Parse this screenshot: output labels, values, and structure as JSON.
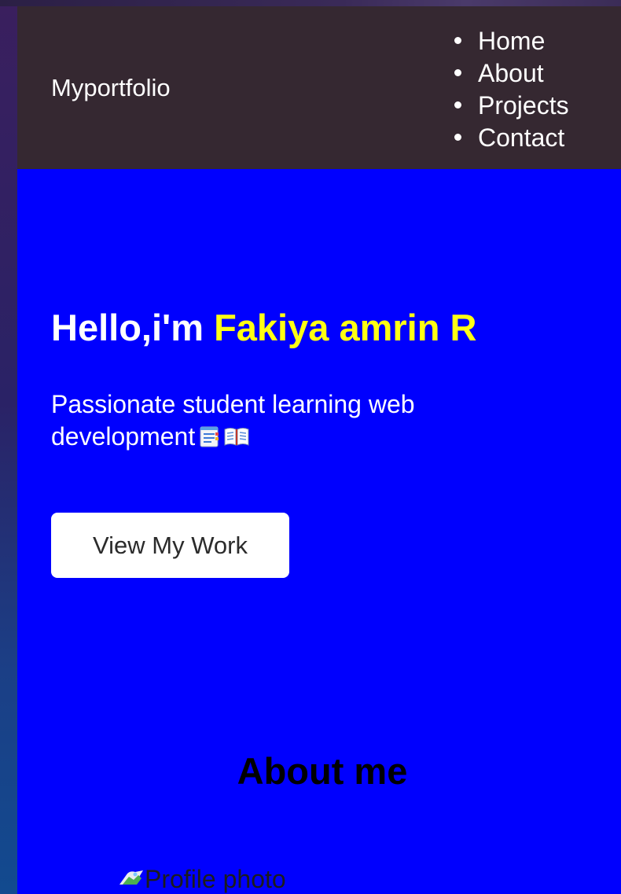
{
  "site": {
    "logo": "Myportfolio"
  },
  "nav": {
    "items": [
      {
        "label": "Home"
      },
      {
        "label": "About"
      },
      {
        "label": "Projects"
      },
      {
        "label": "Contact"
      }
    ]
  },
  "hero": {
    "greeting": "Hello,i'm ",
    "name": "Fakiya amrin R",
    "subtitle": "Passionate student learning web development",
    "emoji_icons": [
      "notepad-icon",
      "open-book-icon"
    ],
    "cta_label": "View My Work"
  },
  "about": {
    "title": "About me",
    "profile_image_alt": "Profile photo",
    "profile_image_icon": "broken-image-icon"
  },
  "colors": {
    "navbar_bg": "#352831",
    "page_bg": "#0000fe",
    "name_highlight": "#ffff14",
    "button_bg": "#ffffff",
    "text_light": "#ffffff",
    "heading_dark": "#000000"
  }
}
